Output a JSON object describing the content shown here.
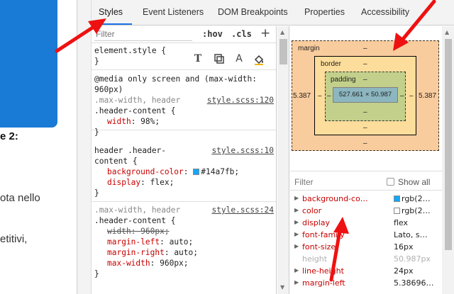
{
  "webpage": {
    "heading_fragment": "e 2:",
    "text_line1": "ota nello",
    "text_line2": "etitivi,",
    "brand_color": "#1a7bd6"
  },
  "tabs": [
    {
      "label": "Styles",
      "active": true
    },
    {
      "label": "Event Listeners",
      "active": false
    },
    {
      "label": "DOM Breakpoints",
      "active": false
    },
    {
      "label": "Properties",
      "active": false
    },
    {
      "label": "Accessibility",
      "active": false
    }
  ],
  "styles_toolbar": {
    "filter_placeholder": "Filter",
    "hov": ":hov",
    "cls": ".cls",
    "add": "+"
  },
  "icons": [
    "text-shadow-icon",
    "box-shadow-icon",
    "text-color-icon",
    "background-color-icon"
  ],
  "rules": {
    "element_style": {
      "selector": "element.style {",
      "close": "}"
    },
    "media": {
      "l1": "@media only screen and (max-width:",
      "l2": "960px)"
    },
    "rule1": {
      "sel1": ".max-width, header",
      "sel2": ".header-content {",
      "source": "style.scss:120",
      "p1_name": "width",
      "p1_val": "98%;",
      "close": "}"
    },
    "rule2": {
      "sel1": "header .header-",
      "sel2": "content {",
      "source": "style.scss:10",
      "p1_name": "background-color",
      "p1_val": "#14a7fb;",
      "p2_name": "display",
      "p2_val": "flex;",
      "close": "}",
      "swatch_color": "#14a7fb"
    },
    "rule3": {
      "sel1": ".max-width, header",
      "sel2": ".header-content {",
      "source": "style.scss:24",
      "p1_name": "width",
      "p1_val": "960px;",
      "p2_name": "margin-left",
      "p2_val": "auto;",
      "p3_name": "margin-right",
      "p3_val": "auto;",
      "p4_name": "max-width",
      "p4_val": "960px;",
      "close": "}"
    }
  },
  "box_model": {
    "margin_label": "margin",
    "margin_top": "–",
    "margin_bottom": "–",
    "margin_left": "5.387",
    "margin_right": "5.387",
    "border_label": "border",
    "border_top": "–",
    "border_bottom": "–",
    "border_left": "–",
    "border_right": "–",
    "padding_label": "padding",
    "padding_top": "–",
    "padding_bottom": "–",
    "padding_left": "–",
    "padding_right": "–",
    "content": "527.661 × 50.987"
  },
  "computed": {
    "filter_placeholder": "Filter",
    "show_all": "Show all",
    "properties": [
      {
        "name": "background-co…",
        "value": "rgb(2…",
        "swatch": "#14a7fb",
        "dim": false
      },
      {
        "name": "color",
        "value": "rgb(2…",
        "swatch": "#ffffff",
        "dim": false
      },
      {
        "name": "display",
        "value": "flex",
        "dim": false
      },
      {
        "name": "font-family",
        "value": "Lato, s…",
        "dim": false
      },
      {
        "name": "font-size",
        "value": "16px",
        "dim": false
      },
      {
        "name": "height",
        "value": "50.987px",
        "dim": true
      },
      {
        "name": "line-height",
        "value": "24px",
        "dim": false
      },
      {
        "name": "margin-left",
        "value": "5.38696…",
        "dim": false
      }
    ]
  },
  "arrow_color": "#ee1111"
}
